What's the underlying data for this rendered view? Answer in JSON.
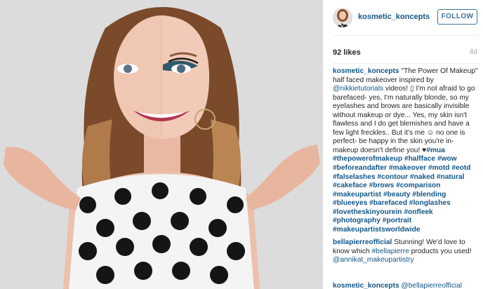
{
  "post": {
    "username": "kosmetic_koncepts",
    "follow_label": "FOLLOW",
    "likes": "92 likes",
    "age": "4d"
  },
  "caption": {
    "author": "kosmetic_koncepts",
    "text_1": " \"The Power Of Makeup\" half faced makeover inspired by ",
    "mention": "@nikkietutorials",
    "text_2": " videos! ",
    "glyph": "▯",
    "text_3": " I'm not afraid to go barefaced- yes, I'm naturally blonde, so my eyelashes and brows are basically invisible without makeup or dye... Yes, my skin isn't flawless and I do get blemishes and have a few light freckles.. But it's me ",
    "smiley": "☺",
    "text_4": " no one is perfect- be happy in the skin you're in- makeup doesn't define you! ",
    "heart": "♥",
    "hashtags": [
      "#mua",
      "#thepowerofmakeup",
      "#halfface",
      "#wow",
      "#beforeandafter",
      "#makeover",
      "#motd",
      "#eotd",
      "#falselashes",
      "#contour",
      "#naked",
      "#natural",
      "#cakeface",
      "#brows",
      "#comparison",
      "#makeupartist",
      "#beauty",
      "#blending",
      "#blueeyes",
      "#barefaced",
      "#longlashes",
      "#lovetheskinyourein",
      "#onfleek",
      "#photography",
      "#portrait",
      "#makeupartistsworldwide"
    ]
  },
  "comment_2": {
    "author": "bellapierreofficial",
    "text_1": " Stunning! We'd love to know which ",
    "mention": "#bellapierre",
    "text_2": " products you used! ",
    "mention_2": "@annikat_makeupartistry"
  },
  "comment_3": {
    "author": "kosmetic_koncepts",
    "mention": "@bellapierreofficial"
  },
  "colors": {
    "link": "#125688",
    "follow": "#3f729b",
    "text": "#262626",
    "muted": "#a5a7aa"
  }
}
